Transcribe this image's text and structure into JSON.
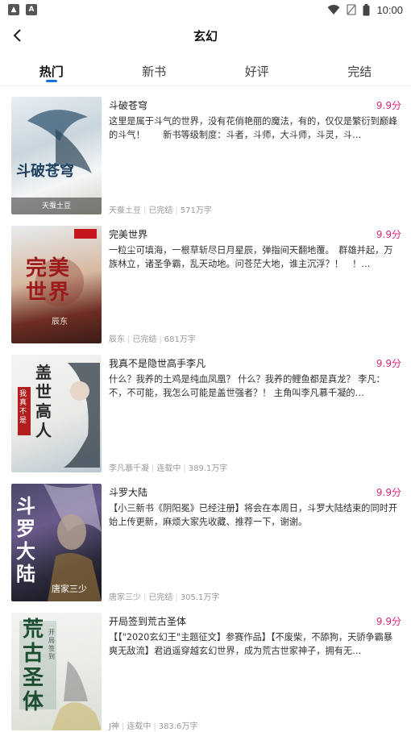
{
  "status": {
    "time": "10:00"
  },
  "header": {
    "title": "玄幻"
  },
  "tabs": [
    {
      "label": "热门"
    },
    {
      "label": "新书"
    },
    {
      "label": "好评"
    },
    {
      "label": "完结"
    }
  ],
  "books": [
    {
      "title": "斗破苍穹",
      "score": "9.9分",
      "desc": "这里是属于斗气的世界，没有花俏艳丽的魔法，有的，仅仅是繁衍到巅峰的斗气！　　新书等级制度：斗者，斗师，大斗师，斗灵，斗…",
      "author": "天蚕土豆",
      "status": "已完结",
      "words": "571万字",
      "cover_text": "斗破苍穹",
      "cover_author": "天蚕土豆"
    },
    {
      "title": "完美世界",
      "score": "9.9分",
      "desc": "一粒尘可填海，一根草斩尽日月星辰，弹指间天翻地覆。　群雄并起，万族林立，诸圣争霸，乱天动地。问苍茫大地，谁主沉浮？！　！…",
      "author": "辰东",
      "status": "已完结",
      "words": "681万字",
      "cover_text": "完美世界",
      "cover_author": "辰东"
    },
    {
      "title": "我真不是隐世高手李凡",
      "score": "9.9分",
      "desc": "什么？我养的土鸡是纯血凤凰？ 什么？我养的鲤鱼都是真龙？ 李凡：不，不可能，我怎么可能是盖世强者？！ 主角叫李凡慕千凝的…",
      "author": "李凡慕千凝",
      "status": "连载中",
      "words": "389.1万字",
      "cover_text": "盖世高人",
      "cover_author": "我真不是"
    },
    {
      "title": "斗罗大陆",
      "score": "9.9分",
      "desc": "【小三新书《阴阳冕》已经注册】将会在本周日，斗罗大陆结束的同时开始上传更新，麻烦大家先收藏、推荐一下，谢谢。",
      "author": "唐家三少",
      "status": "已完结",
      "words": "305.1万字",
      "cover_text": "斗罗大陆",
      "cover_author": "唐家三少"
    },
    {
      "title": "开局签到荒古圣体",
      "score": "9.9分",
      "desc": "【【\"2020玄幻王\"主题征文】参赛作品】【不废柴，不舔狗，天骄争霸暴爽无敌流】君逍遥穿越玄幻世界，成为荒古世家神子，拥有无…",
      "author": "J神",
      "status": "连载中",
      "words": "383.6万字",
      "cover_text": "荒古圣体",
      "cover_author": "开局签到"
    }
  ],
  "colors": {
    "accent": "#1e6fe0",
    "score": "#e0287a"
  }
}
